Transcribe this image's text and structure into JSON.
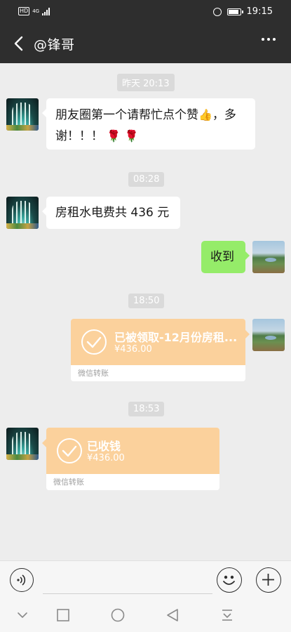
{
  "status_bar": {
    "network": "HD",
    "signal_type": "4G",
    "time": "19:15"
  },
  "header": {
    "back_icon": "chevron-left-icon",
    "title": "@锋哥",
    "more_icon": "more-dots-icon"
  },
  "messages": {
    "ts1": "昨天 20:13",
    "msg1_text": "朋友圈第一个请帮忙点个赞",
    "msg1_tail": "，多",
    "msg1_line2": "谢！！！",
    "ts2": "08:28",
    "msg2_text": "房租水电费共 436 元",
    "msg3_text": "收到",
    "ts3": "18:50",
    "transfer1": {
      "title": "已被领取-12月份房租...",
      "amount": "¥436.00",
      "footer": "微信转账"
    },
    "ts4": "18:53",
    "transfer2": {
      "title": "已收钱",
      "amount": "¥436.00",
      "footer": "微信转账"
    }
  },
  "colors": {
    "top_bar": "#2e2e2e",
    "chat_bg": "#ededed",
    "sent_bubble": "#95ec69",
    "transfer_card": "#fbd19c"
  },
  "input_bar": {
    "voice_icon": "voice-icon",
    "emoji_icon": "emoji-icon",
    "plus_icon": "plus-icon",
    "text_value": ""
  },
  "system_nav": [
    "collapse-icon",
    "recent-apps-icon",
    "home-icon",
    "back-icon",
    "notification-icon"
  ]
}
